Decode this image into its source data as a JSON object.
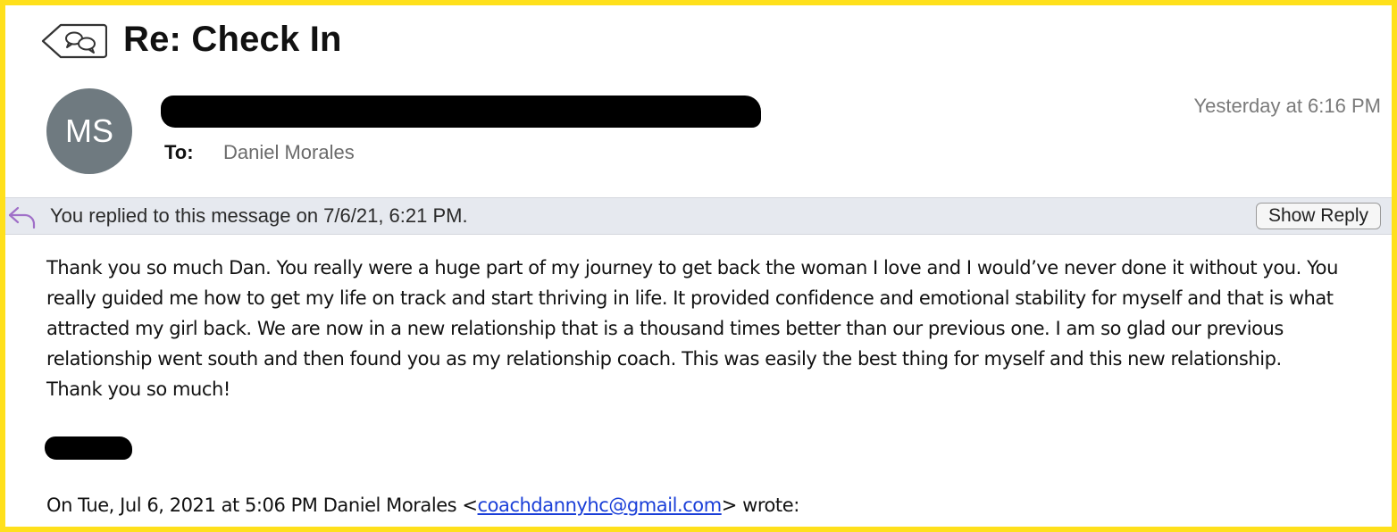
{
  "header": {
    "subject": "Re: Check In",
    "avatar_initials": "MS",
    "to_label": "To:",
    "to_name": "Daniel Morales",
    "timestamp": "Yesterday at 6:16 PM",
    "back_icon": "back-conversation-icon"
  },
  "replied_banner": {
    "text": "You replied to this message on 7/6/21, 6:21 PM.",
    "button_label": "Show Reply",
    "icon": "reply-arrow-icon"
  },
  "message": {
    "paragraph": "Thank you so much Dan. You really were a huge part of my journey to get back the woman I love and I would’ve never done it without you. You really guided me how to get my life on track and start thriving in life. It provided confidence and emotional stability for myself and that is what attracted my girl back. We are now in a new relationship that is a thousand times better than our previous one. I am so glad our previous relationship went south and then found you as my relationship coach. This was easily the best thing for myself and this new relationship.",
    "closing": "Thank you so much!"
  },
  "quote": {
    "prefix": "On Tue, Jul 6, 2021 at 5:06 PM Daniel Morales <",
    "email": "coachdannyhc@gmail.com",
    "suffix": "> wrote:"
  },
  "colors": {
    "frame": "#ffe01b",
    "avatar": "#6f7a80",
    "banner": "#e6e9ef",
    "link": "#1a3fd8",
    "reply_icon": "#a070c8"
  }
}
